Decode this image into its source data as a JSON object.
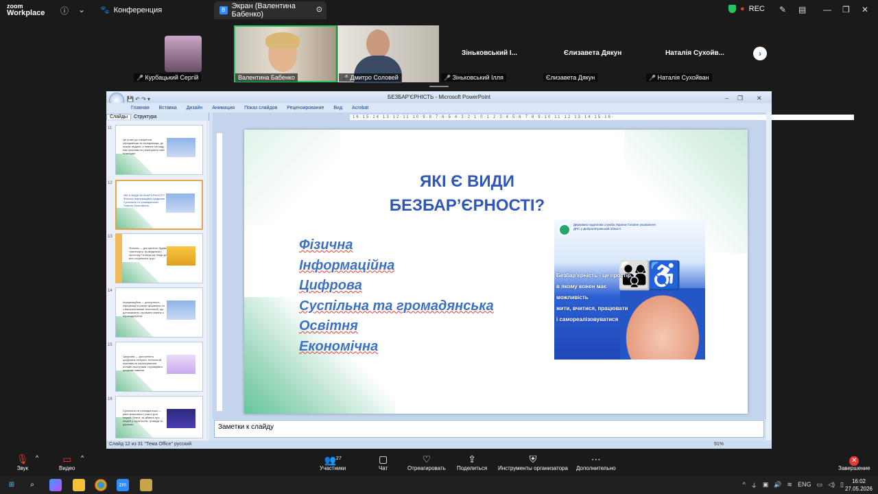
{
  "zoom": {
    "logo_top": "zoom",
    "logo_bottom": "Workplace",
    "meeting_label": "Конференция",
    "screen_tab": "Экран (Валентина Бабенко)",
    "rec": "REC"
  },
  "participants": [
    {
      "name": "Курбацький Сергій"
    },
    {
      "name": "Валентина Бабенко"
    },
    {
      "name": "Дмитро Соловей"
    },
    {
      "name": "Зіньковський Ілля",
      "heading": "Зіньковський І..."
    },
    {
      "name": "Єлизавета Дякун",
      "heading": "Єлизавета Дякун"
    },
    {
      "name": "Наталія Сухойван",
      "heading": "Наталія Сухойв..."
    }
  ],
  "ppt": {
    "window_title": "БЕЗБАР'ЄРНІСТЬ - Microsoft PowerPoint",
    "menu": [
      "Главная",
      "Вставка",
      "Дизайн",
      "Анимация",
      "Показ слайдов",
      "Рецензирование",
      "Вид",
      "Acrobat"
    ],
    "pane_tabs": [
      "Слайды",
      "Структура"
    ],
    "ruler": "·16·15·14·13·12·11·10·9·8·7·6·5·4·3·2·1·0·1·2·3·4·5·6·7·8·9·10·11·12·13·14·15·16·",
    "thumbs": [
      {
        "num": "11",
        "text": "Це шлях до створення середовища та середовища, де кожна людина, з певних погляду має можливість реалізувати свій потенціал."
      },
      {
        "num": "12",
        "text": "ЯКІ Є ВИДИ БЕЗБАР'ЄРНОСТІ? Фізична Інформаційна Цифрова Суспільна та громадянська Освітня Економічна"
      },
      {
        "num": "13",
        "text": "Фізична — доступність будівель, транспорту, громадського простору та місць де люди для всіх соціальних груп."
      },
      {
        "num": "14",
        "text": "Інформаційна — доступність інформації в різних форматах та з використанням технологій, що допомагають отримати знання з першоджерела."
      },
      {
        "num": "15",
        "text": "Цифрова — доступність цифрових інтернет-технологій, можливість користуватися онлайн-послугами, отримувати цифрові навички."
      },
      {
        "num": "16",
        "text": "Суспільна та громадянська — рівні можливості участі для людей. Знати, як дбають про людей у суспільстві, громаді та державі."
      }
    ],
    "slide": {
      "title_line1": "ЯКІ Є ВИДИ",
      "title_line2": "БЕЗБАР’ЄРНОСТІ?",
      "items": [
        "Фізична",
        "Інформаційна",
        "Цифрова",
        "Суспільна та громадянська",
        "Освітня",
        "Економічна"
      ],
      "banner_org": "Державна податкова служба України Головне управління ДПС у Дніпропетровській області",
      "banner_lines": [
        "Безбар’єрність - це простір,",
        "в якому кожен має можливість",
        "жити, вчитися, працювати",
        "і самореалізовуватися"
      ]
    },
    "notes": "Заметки к слайду",
    "status_left": "Слайд 12 из 31   \"Тема Office\"   русский",
    "zoom": "91%"
  },
  "controls": {
    "sound": "Звук",
    "video": "Видео",
    "participants": "Участники",
    "participants_count": "27",
    "chat": "Чат",
    "react": "Отреагировать",
    "share": "Поделиться",
    "host_tools": "Инструменты организатора",
    "more": "Дополнительно",
    "end": "Завершение"
  },
  "taskbar": {
    "lang": "ENG",
    "time": "16:02",
    "date": "27.05.2026"
  }
}
